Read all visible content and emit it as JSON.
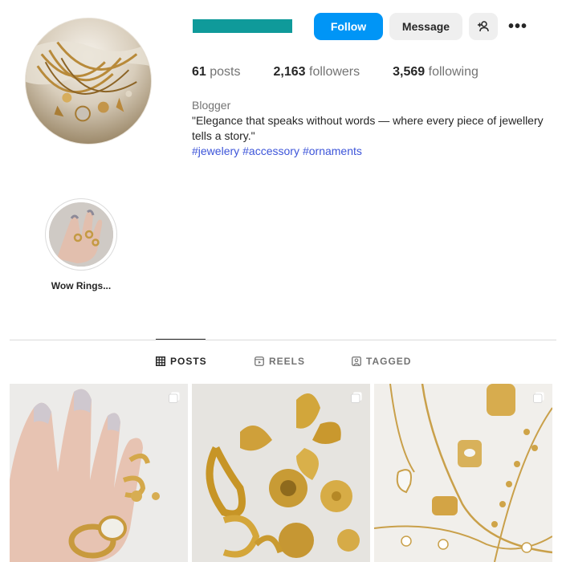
{
  "profile": {
    "follow_label": "Follow",
    "message_label": "Message",
    "add_user_icon": "add-user-icon",
    "more_label": "•••"
  },
  "stats": [
    {
      "value": "61",
      "label": "posts"
    },
    {
      "value": "2,163",
      "label": "followers"
    },
    {
      "value": "3,569",
      "label": "following"
    }
  ],
  "bio": {
    "category": "Blogger",
    "text": "\"Elegance that speaks without words — where every piece of jewellery tells a story.\"",
    "tags": [
      "#jewelery",
      "#accessory",
      "#ornaments"
    ]
  },
  "highlights": [
    {
      "label": "Wow Rings..."
    }
  ],
  "tabs": [
    {
      "label": "POSTS",
      "icon": "grid-icon",
      "active": true
    },
    {
      "label": "REELS",
      "icon": "reels-icon",
      "active": false
    },
    {
      "label": "TAGGED",
      "icon": "tagged-icon",
      "active": false
    }
  ],
  "posts": [
    {
      "subject": "hand with gold rings",
      "multi_icon": "carousel-icon"
    },
    {
      "subject": "gold leaf and flower jewellery",
      "multi_icon": "carousel-icon"
    },
    {
      "subject": "gold chain necklaces and rings",
      "multi_icon": "carousel-icon"
    }
  ],
  "colors": {
    "accent": "#0095f6",
    "username_bar": "#0f9a9a",
    "hashtag": "#3d55d9",
    "muted": "#737373"
  }
}
